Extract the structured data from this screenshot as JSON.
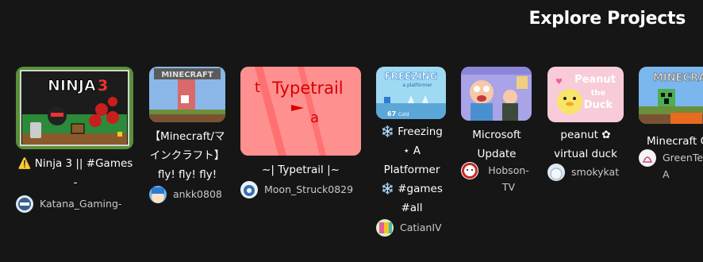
{
  "section_title": "Explore Projects",
  "projects": [
    {
      "title": "⚠️ Ninja 3 || #Games -",
      "author": "Katana_Gaming-",
      "thumb_text": "NINJA 3"
    },
    {
      "title": "【Minecraft/マインクラフト】fly! fly! fly!",
      "author": "ankk0808",
      "thumb_text": "MINECRAFT"
    },
    {
      "title": "~| Typetrail |~",
      "author": "Moon_Struck0829",
      "thumb_text": "Typetrail"
    },
    {
      "title": "❄️ Freezing ⋆ A Platformer ❄️ #games #all",
      "author": "CatianIV",
      "thumb_text": "FREEZING",
      "thumb_sub": "a platformer",
      "thumb_count": "67",
      "thumb_count_label": "Cold"
    },
    {
      "title": "Microsoft Update",
      "author": "Hobson-TV"
    },
    {
      "title": "peanut ✿ virtual duck",
      "author": "smokykat",
      "thumb_text": "Peanut the Duck"
    },
    {
      "title": "Minecraft C",
      "author": "GreenTe A",
      "thumb_text": "MINECRAFT"
    }
  ]
}
